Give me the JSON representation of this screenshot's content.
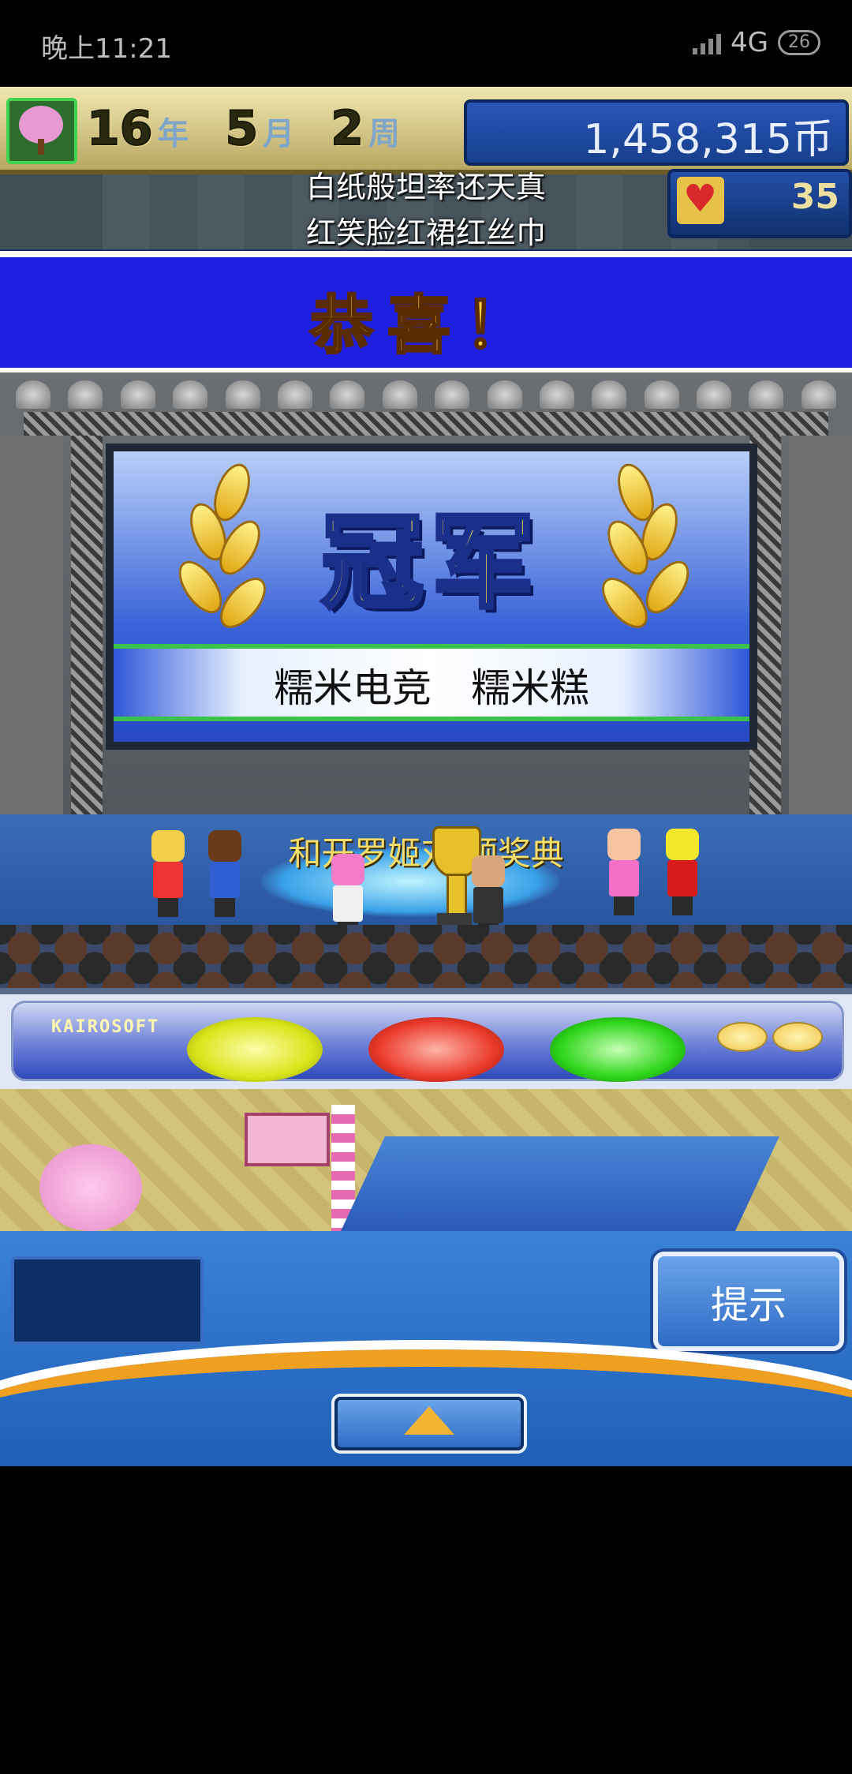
{
  "status_bar": {
    "time": "晚上11:21",
    "network": "4G",
    "battery": "26"
  },
  "hud": {
    "year_value": "16",
    "year_unit": "年",
    "month_value": "5",
    "month_unit": "月",
    "week_value": "2",
    "week_unit": "周",
    "money": "1,458,315币",
    "hearts": "35"
  },
  "lyrics": {
    "line1": "白纸般坦率还天真",
    "line2": "红笑脸红裙红丝巾"
  },
  "banner": {
    "title": "恭喜！"
  },
  "screen": {
    "headline": "冠军",
    "winner": "糯米电竞　糯米糕"
  },
  "stage": {
    "caption": "和开罗姬对  颁奖典"
  },
  "controls": {
    "brand": "KAIROSOFT"
  },
  "panel": {
    "hint_label": "提示"
  },
  "colors": {
    "banner_bg": "#1e1ee0",
    "banner_text": "#ffd23a",
    "panel_bg": "#2f6bc4",
    "accent_orange": "#f0a020"
  }
}
